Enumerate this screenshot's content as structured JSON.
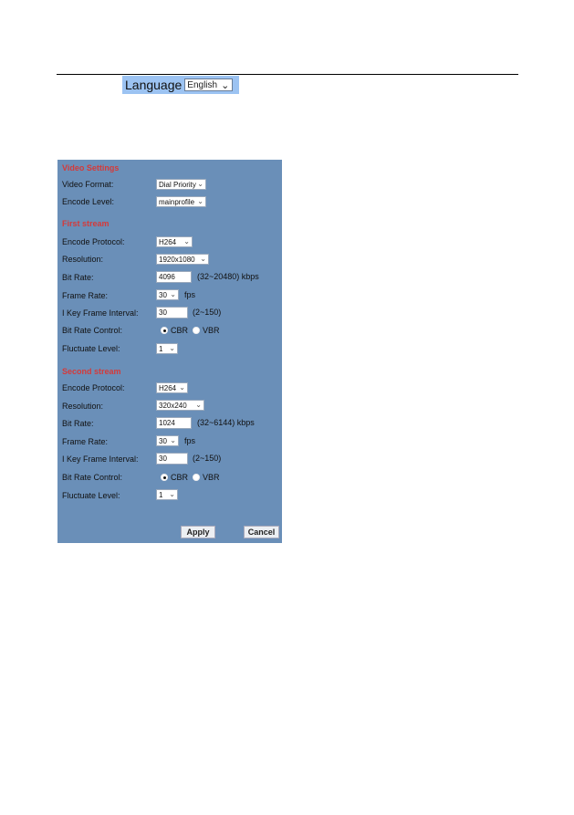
{
  "header": {
    "language_label": "Language",
    "language_value": "English"
  },
  "video_settings": {
    "title": "Video Settings",
    "video_format": {
      "label": "Video Format:",
      "value": "Dial Priority"
    },
    "encode_level": {
      "label": "Encode Level:",
      "value": "mainprofile"
    }
  },
  "first_stream": {
    "title": "First stream",
    "encode_protocol": {
      "label": "Encode Protocol:",
      "value": "H264"
    },
    "resolution": {
      "label": "Resolution:",
      "value": "1920x1080"
    },
    "bit_rate": {
      "label": "Bit Rate:",
      "value": "4096",
      "hint": "(32~20480) kbps"
    },
    "frame_rate": {
      "label": "Frame Rate:",
      "value": "30",
      "unit": "fps"
    },
    "i_key_frame_interval": {
      "label": "I Key Frame Interval:",
      "value": "30",
      "hint": "(2~150)"
    },
    "bit_rate_control": {
      "label": "Bit Rate Control:",
      "options": [
        "CBR",
        "VBR"
      ],
      "selected": "CBR"
    },
    "fluctuate_level": {
      "label": "Fluctuate Level:",
      "value": "1"
    }
  },
  "second_stream": {
    "title": "Second stream",
    "encode_protocol": {
      "label": "Encode Protocol:",
      "value": "H264"
    },
    "resolution": {
      "label": "Resolution:",
      "value": "320x240"
    },
    "bit_rate": {
      "label": "Bit Rate:",
      "value": "1024",
      "hint": "(32~6144) kbps"
    },
    "frame_rate": {
      "label": "Frame Rate:",
      "value": "30",
      "unit": "fps"
    },
    "i_key_frame_interval": {
      "label": "I Key Frame Interval:",
      "value": "30",
      "hint": "(2~150)"
    },
    "bit_rate_control": {
      "label": "Bit Rate Control:",
      "options": [
        "CBR",
        "VBR"
      ],
      "selected": "CBR"
    },
    "fluctuate_level": {
      "label": "Fluctuate Level:",
      "value": "1"
    }
  },
  "actions": {
    "apply": "Apply",
    "cancel": "Cancel"
  },
  "icons": {
    "chevron": "chevron-down-icon"
  },
  "colors": {
    "panel_bg": "#6a8fb8",
    "section_title": "#d43a3a",
    "language_bar": "#9cc3f2"
  }
}
